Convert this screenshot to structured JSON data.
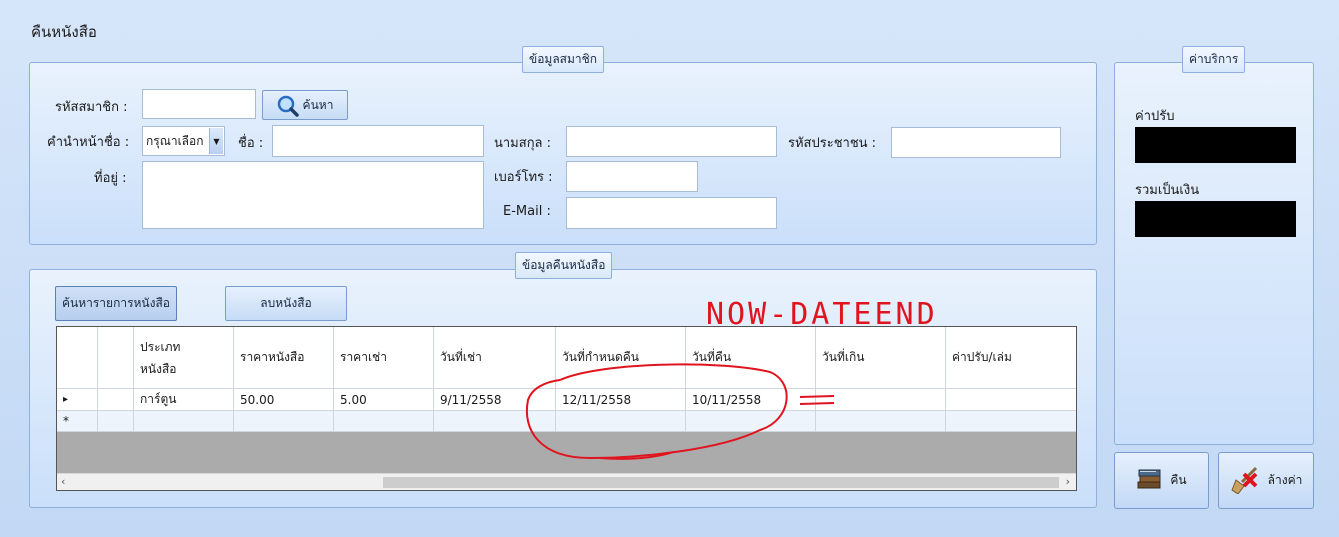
{
  "form": {
    "title": "คืนหนังสือ"
  },
  "member": {
    "caption": "ข้อมูลสมาชิก",
    "id_label": "รหัสสมาชิก :",
    "id_value": "",
    "search_button": "ค้นหา",
    "prefix_label": "คำนำหน้าชื่อ :",
    "prefix_selected": "กรุณาเลือก",
    "name_label": "ชื่อ :",
    "name_value": "",
    "lastname_label": "นามสกุล :",
    "lastname_value": "",
    "citizen_label": "รหัสประชาชน :",
    "citizen_value": "",
    "address_label": "ที่อยู่ :",
    "address_value": "",
    "phone_label": "เบอร์โทร :",
    "phone_value": "",
    "email_label": "E-Mail :",
    "email_value": ""
  },
  "fee": {
    "caption": "ค่าบริการ",
    "fine_label": "ค่าปรับ",
    "total_label": "รวมเป็นเงิน"
  },
  "return_info": {
    "caption": "ข้อมูลคืนหนังสือ",
    "search_books_button": "ค้นหารายการหนังสือ",
    "delete_book_button": "ลบหนังสือ",
    "columns": [
      "",
      "ประเภท\nหนังสือ",
      "ราคาหนังสือ",
      "ราคาเช่า",
      "วันที่เช่า",
      "วันที่กำหนดคืน",
      "วันที่คืน",
      "วันที่เกิน",
      "ค่าปรับ/เล่ม"
    ],
    "rows": [
      [
        "",
        "การ์ตูน",
        "50.00",
        "5.00",
        "9/11/2558",
        "12/11/2558",
        "10/11/2558",
        "",
        ""
      ]
    ],
    "new_row_marker": "*",
    "current_row_marker": "▸"
  },
  "actions": {
    "return_button": "คืน",
    "clear_button": "ล้างค่า"
  },
  "annotation": {
    "text": "NOW-DATEEND",
    "equals": "="
  },
  "colors": {
    "annotation": "#e0141e",
    "accent_border": "#8fb0dc"
  }
}
